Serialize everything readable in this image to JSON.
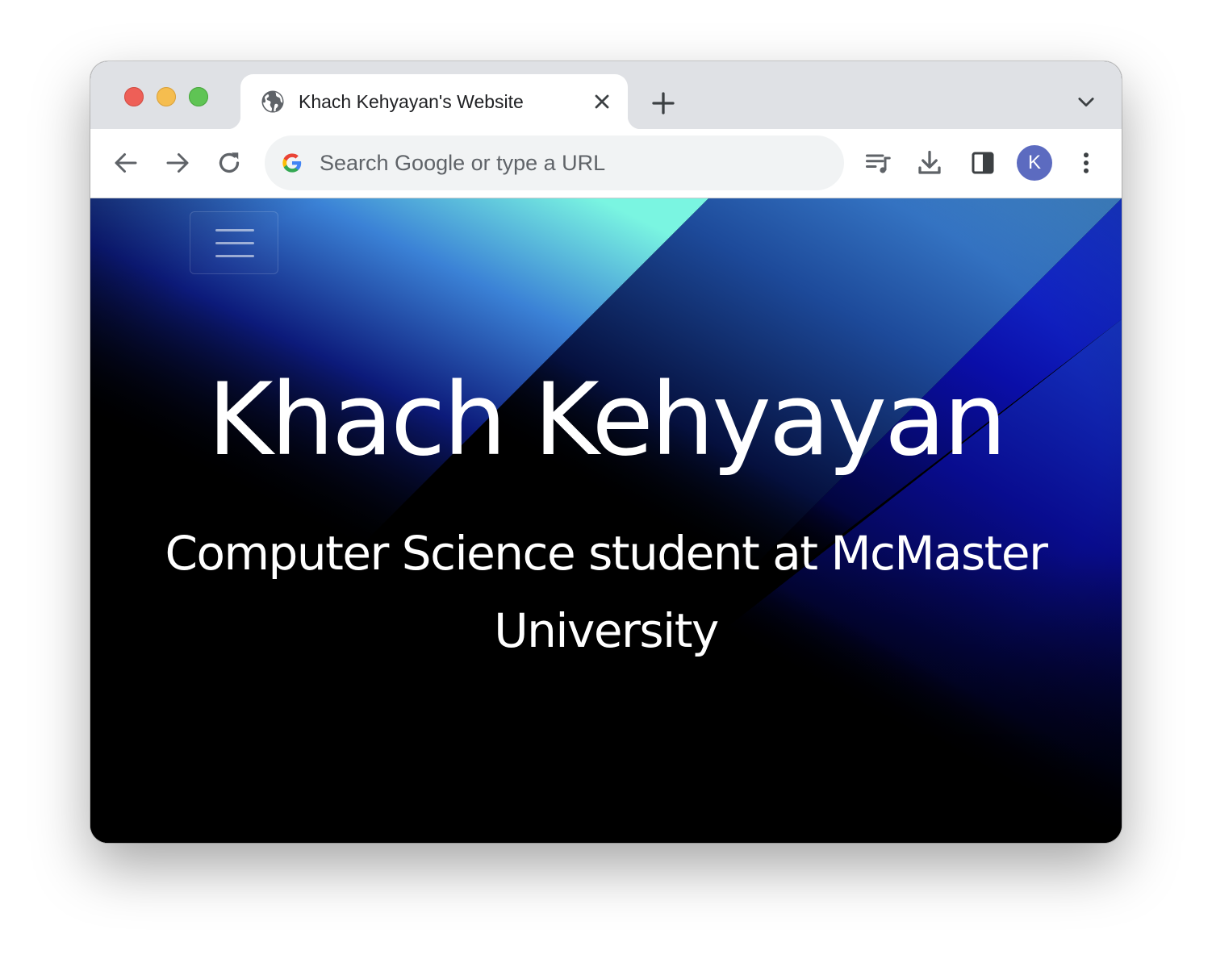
{
  "browser": {
    "tab": {
      "title": "Khach Kehyayan's Website",
      "favicon": "globe-icon"
    },
    "omnibox": {
      "placeholder": "Search Google or type a URL",
      "value": ""
    },
    "profile_initial": "K",
    "icons": {
      "back": "back-arrow-icon",
      "forward": "forward-arrow-icon",
      "reload": "reload-icon",
      "media": "media-queue-icon",
      "downloads": "download-icon",
      "side_panel": "side-panel-icon",
      "menu": "kebab-menu-icon",
      "new_tab": "plus-icon",
      "tab_search": "chevron-down-icon"
    },
    "colors": {
      "tabstrip": "#dfe1e5",
      "toolbar": "#ffffff",
      "omnibox": "#f1f3f4",
      "avatar": "#5c6bc0",
      "traffic_red": "#ee5f57",
      "traffic_yellow": "#f5bd4f",
      "traffic_green": "#5fc454"
    }
  },
  "page": {
    "title": "Khach Kehyayan",
    "subtitle": "Computer Science student at McMaster University",
    "colors": {
      "background": "#000000",
      "accent_cyan": "#7af5e1",
      "accent_blue": "#3b82d6",
      "accent_deep": "#1a1fd8"
    }
  }
}
